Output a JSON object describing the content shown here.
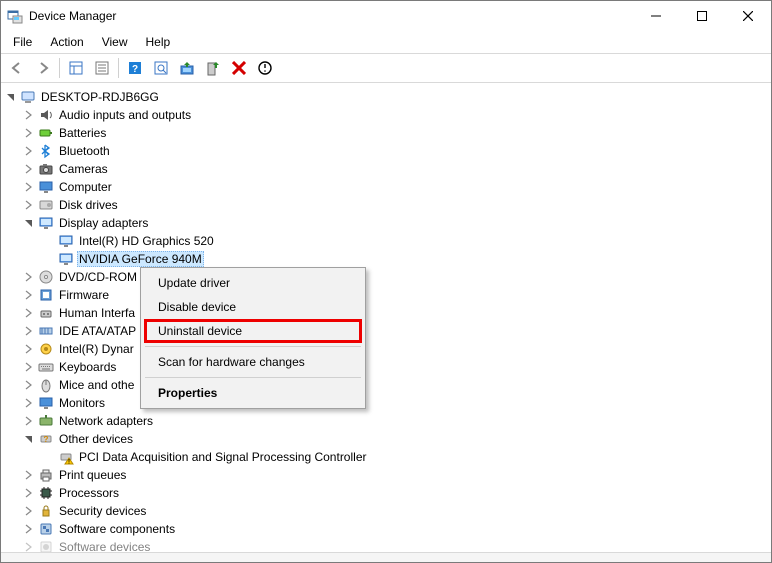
{
  "window": {
    "title": "Device Manager"
  },
  "menu": {
    "file": "File",
    "action": "Action",
    "view": "View",
    "help": "Help"
  },
  "root": {
    "label": "DESKTOP-RDJB6GG"
  },
  "categories": [
    {
      "id": "audio",
      "label": "Audio inputs and outputs",
      "chev": "right"
    },
    {
      "id": "batteries",
      "label": "Batteries",
      "chev": "right"
    },
    {
      "id": "bluetooth",
      "label": "Bluetooth",
      "chev": "right"
    },
    {
      "id": "cameras",
      "label": "Cameras",
      "chev": "right"
    },
    {
      "id": "computer",
      "label": "Computer",
      "chev": "right"
    },
    {
      "id": "disk",
      "label": "Disk drives",
      "chev": "right"
    },
    {
      "id": "display",
      "label": "Display adapters",
      "chev": "down",
      "children": [
        {
          "id": "intel",
          "label": "Intel(R) HD Graphics 520"
        },
        {
          "id": "nvidia",
          "label": "NVIDIA GeForce 940M",
          "selected": true
        }
      ]
    },
    {
      "id": "dvd",
      "label": "DVD/CD-ROM",
      "chev": "right",
      "cut": true
    },
    {
      "id": "firmware",
      "label": "Firmware",
      "chev": "right"
    },
    {
      "id": "hid",
      "label": "Human Interfa",
      "chev": "right",
      "cut": true
    },
    {
      "id": "ide",
      "label": "IDE ATA/ATAP",
      "chev": "right",
      "cut": true
    },
    {
      "id": "dynamic",
      "label": "Intel(R) Dynar",
      "chev": "right",
      "cut": true
    },
    {
      "id": "keyboards",
      "label": "Keyboards",
      "chev": "right"
    },
    {
      "id": "mice",
      "label": "Mice and othe",
      "chev": "right",
      "cut": true
    },
    {
      "id": "monitors",
      "label": "Monitors",
      "chev": "right"
    },
    {
      "id": "network",
      "label": "Network adapters",
      "chev": "right"
    },
    {
      "id": "other",
      "label": "Other devices",
      "chev": "down",
      "children": [
        {
          "id": "pci",
          "label": "PCI Data Acquisition and Signal Processing Controller",
          "warn": true
        }
      ]
    },
    {
      "id": "print",
      "label": "Print queues",
      "chev": "right"
    },
    {
      "id": "processors",
      "label": "Processors",
      "chev": "right"
    },
    {
      "id": "security",
      "label": "Security devices",
      "chev": "right"
    },
    {
      "id": "swcomp",
      "label": "Software components",
      "chev": "right"
    },
    {
      "id": "swdev",
      "label": "Software devices",
      "chev": "right",
      "faded": true
    }
  ],
  "context_menu": {
    "update": "Update driver",
    "disable": "Disable device",
    "uninstall": "Uninstall device",
    "scan": "Scan for hardware changes",
    "properties": "Properties"
  }
}
